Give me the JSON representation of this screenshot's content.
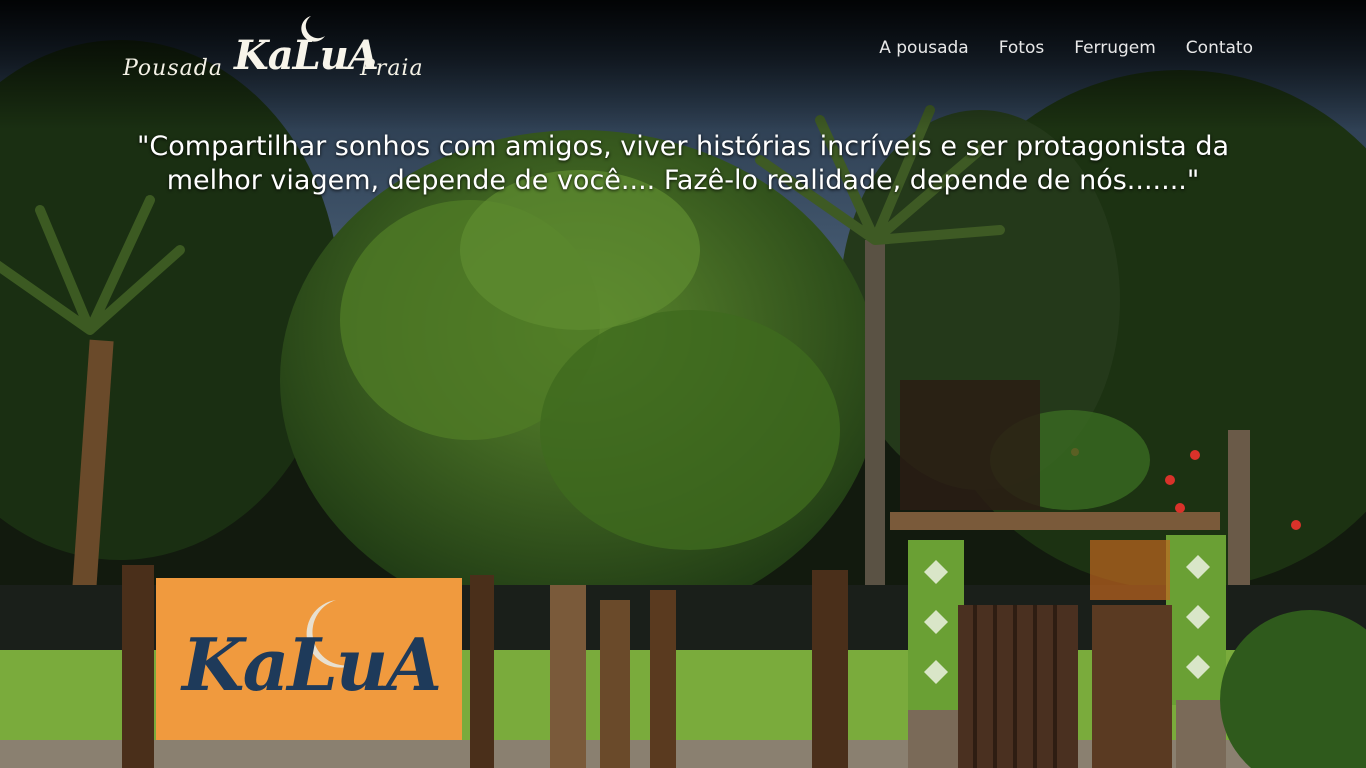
{
  "logo": {
    "prefix": "Pousada",
    "brand": "KaLuA",
    "suffix": "Praia"
  },
  "nav": {
    "items": [
      {
        "label": "A pousada"
      },
      {
        "label": "Fotos"
      },
      {
        "label": "Ferrugem"
      },
      {
        "label": "Contato"
      }
    ]
  },
  "hero": {
    "quote": "\"Compartilhar sonhos com amigos, viver histórias incríveis e ser protagonista da melhor viagem, depende de você.... Fazê-lo realidade, depende de nós.......\"",
    "sign_text": "KaLuA"
  },
  "colors": {
    "nav_text": "#e8e8e8",
    "sign_orange": "#f09a3e",
    "wall_green": "#7aab3c",
    "foliage_dark": "#1f3a14"
  }
}
